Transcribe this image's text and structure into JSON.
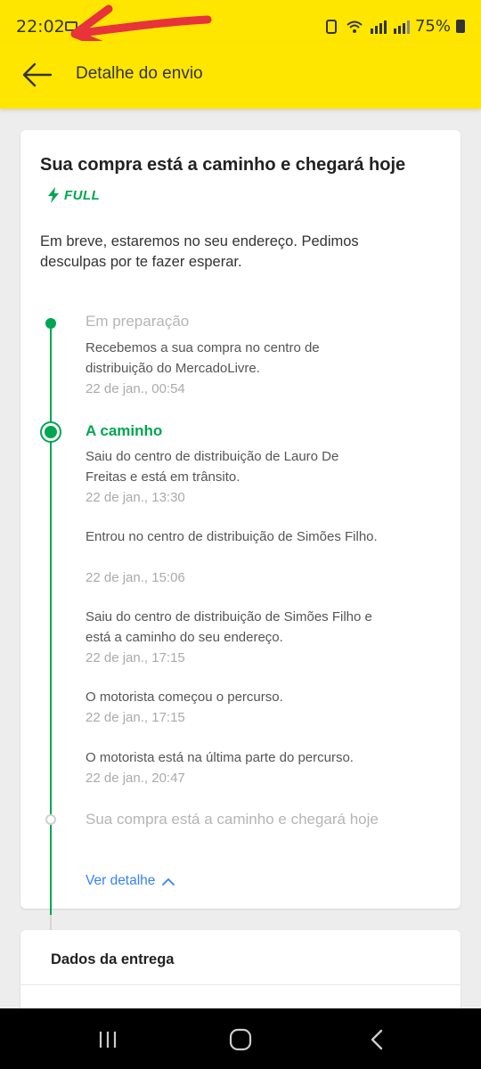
{
  "status_bar": {
    "time": "22:02",
    "battery": "75%"
  },
  "app_bar": {
    "title": "Detalhe do envio"
  },
  "shipment": {
    "title": "Sua compra está a caminho e chegará hoje",
    "badge": "FULL",
    "description": "Em breve, estaremos no seu endereço. Pedimos desculpas por te fazer esperar.",
    "timeline": {
      "step1": {
        "heading": "Em preparação",
        "text": "Recebemos a sua compra no centro de distribuição do MercadoLivre.",
        "date": "22 de jan., 00:54"
      },
      "step2": {
        "heading": "A caminho",
        "events": [
          {
            "text": "Saiu do centro de distribuição de Lauro De Freitas e está em trânsito.",
            "date": "22 de jan., 13:30"
          },
          {
            "text": "Entrou no centro de distribuição de Simões Filho.",
            "date": "22 de jan., 15:06"
          },
          {
            "text": "Saiu do centro de distribuição de Simões Filho e está a caminho do seu endereço.",
            "date": "22 de jan., 17:15"
          },
          {
            "text": "O motorista começou o percurso.",
            "date": "22 de jan., 17:15"
          },
          {
            "text": "O motorista está na última parte do percurso.",
            "date": "22 de jan., 20:47"
          }
        ]
      },
      "step3": {
        "heading": "Sua compra está a caminho e chegará hoje"
      }
    },
    "details_link": "Ver detalhe"
  },
  "delivery": {
    "title": "Dados da entrega"
  },
  "colors": {
    "brand_yellow": "#ffe600",
    "success_green": "#00a650",
    "link_blue": "#3483fa"
  },
  "icons": [
    "back-arrow-icon",
    "lightning-icon",
    "chevron-up-icon",
    "recents-icon",
    "home-icon",
    "nav-back-icon"
  ]
}
